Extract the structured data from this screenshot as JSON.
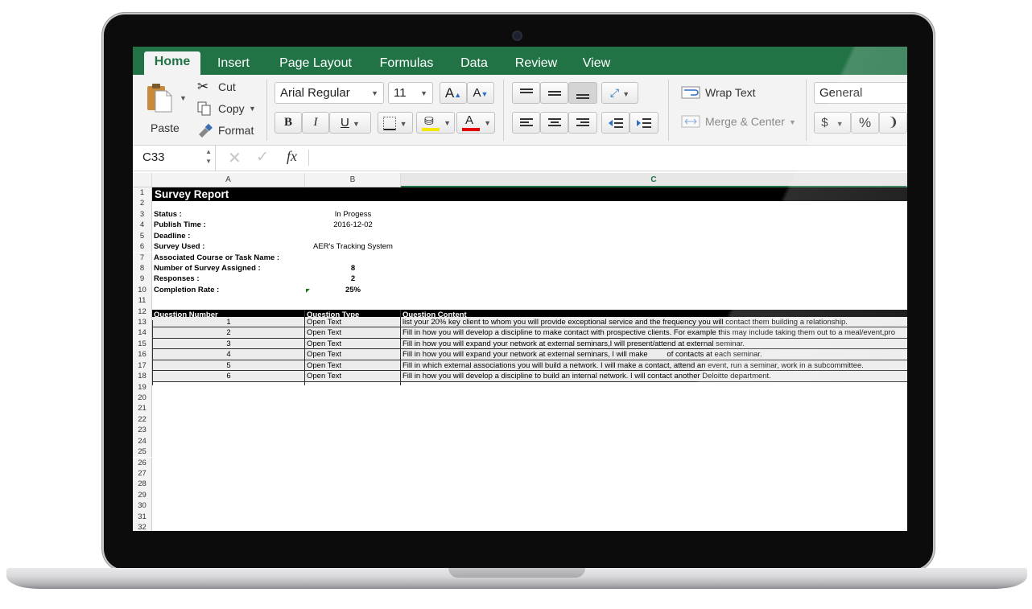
{
  "ribbon": {
    "tabs": [
      "Home",
      "Insert",
      "Page Layout",
      "Formulas",
      "Data",
      "Review",
      "View"
    ],
    "paste_label": "Paste",
    "cut_label": "Cut",
    "copy_label": "Copy",
    "format_label": "Format",
    "font_name": "Arial Regular",
    "font_size": "11",
    "wrap_text_label": "Wrap Text",
    "merge_center_label": "Merge & Center",
    "number_format": "General",
    "currency_symbol": "$",
    "percent_symbol": "%",
    "fill_color": "#f6e500",
    "font_color": "#e30000"
  },
  "formula_bar": {
    "cell_ref": "C33",
    "fx_label": "fx",
    "formula": ""
  },
  "sheet": {
    "columns": [
      "A",
      "B",
      "C"
    ],
    "rows": [
      "1",
      "2",
      "3",
      "4",
      "5",
      "6",
      "7",
      "8",
      "9",
      "10",
      "11",
      "12",
      "13",
      "14",
      "15",
      "16",
      "17",
      "18",
      "19",
      "20",
      "21",
      "22",
      "23",
      "24",
      "25",
      "26",
      "27",
      "28",
      "29",
      "30",
      "31",
      "32"
    ],
    "title": "Survey Report",
    "info": [
      {
        "label": "Status :",
        "value": "In Progess"
      },
      {
        "label": "Publish Time :",
        "value": "2016-12-02"
      },
      {
        "label": "Deadline :",
        "value": ""
      },
      {
        "label": "Survey Used :",
        "value": "AER's Tracking System"
      },
      {
        "label": "Associated Course or Task Name :",
        "value": ""
      },
      {
        "label": "Number of Survey Assigned :",
        "value": "8"
      },
      {
        "label": "Responses :",
        "value": "2"
      },
      {
        "label": "Completion Rate :",
        "value": "25%"
      }
    ],
    "table_headers": [
      "Question Number",
      "Question Type",
      "Question Content"
    ],
    "questions": [
      {
        "num": "1",
        "type": "Open Text",
        "content": "list your 20% key client to whom you will provide exceptional service and the frequency you will contact them building a relationship."
      },
      {
        "num": "2",
        "type": "Open Text",
        "content": "Fill in how you will develop a discipline to make contact with prospective clients. For example this may include taking them out to a meal/event,pro"
      },
      {
        "num": "3",
        "type": "Open Text",
        "content": "Fill in how you will expand your network at external seminars,I will present/attend at external seminar."
      },
      {
        "num": "4",
        "type": "Open Text",
        "content": "Fill in how you will expand your network at external seminars, I will make         of contacts at each seminar."
      },
      {
        "num": "5",
        "type": "Open Text",
        "content": "Fill in which external associations you will build a network. I will make a contact, attend an event, run a seminar, work in a subcommittee."
      },
      {
        "num": "6",
        "type": "Open Text",
        "content": "Fill in how you will develop a discipline to build an internal network. I will contact another Deloitte department."
      }
    ]
  }
}
